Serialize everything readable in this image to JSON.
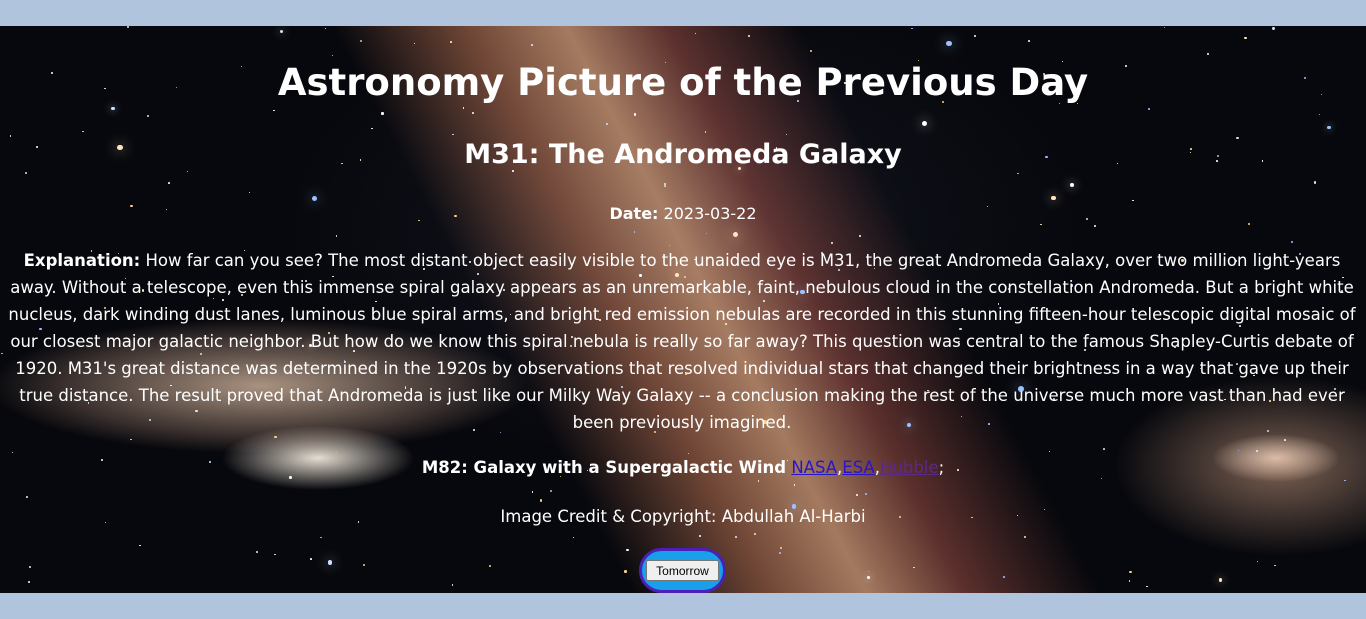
{
  "page": {
    "heading": "Astronomy Picture of the Previous Day",
    "title": "M31: The Andromeda Galaxy",
    "date_label": "Date:",
    "date_value": " 2023-03-22",
    "explanation_label": "Explanation:",
    "explanation_text": " How far can you see? The most distant object easily visible to the unaided eye is M31, the great Andromeda Galaxy, over two million light-years away. Without a telescope, even this immense spiral galaxy appears as an unremarkable, faint, nebulous cloud in the constellation Andromeda. But a bright white nucleus, dark winding dust lanes, luminous blue spiral arms, and bright red emission nebulas are recorded in this stunning fifteen-hour telescopic digital mosaic of our closest major galactic neighbor. But how do we know this spiral nebula is really so far away? This question was central to the famous Shapley-Curtis debate of 1920. M31's great distance was determined in the 1920s by observations that resolved individual stars that changed their brightness in a way that gave up their true distance. The result proved that Andromeda is just like our Milky Way Galaxy -- a conclusion making the rest of the universe much more vast than had ever been previously imagined.",
    "related_label": "M82: Galaxy with a Supergalactic Wind",
    "links": [
      "NASA",
      "ESA",
      "Hubble"
    ],
    "link_sep": ",",
    "link_end": ";",
    "credit": "Image Credit & Copyright: Abdullah Al-Harbi",
    "button_label": "Tomorrow"
  },
  "colors": {
    "page_bg": "#b0c4de",
    "link": "#2a14c9",
    "link_visited": "#5c2a86",
    "button_ring": "#18a0ea",
    "button_ring_border": "#4b1fb8"
  }
}
